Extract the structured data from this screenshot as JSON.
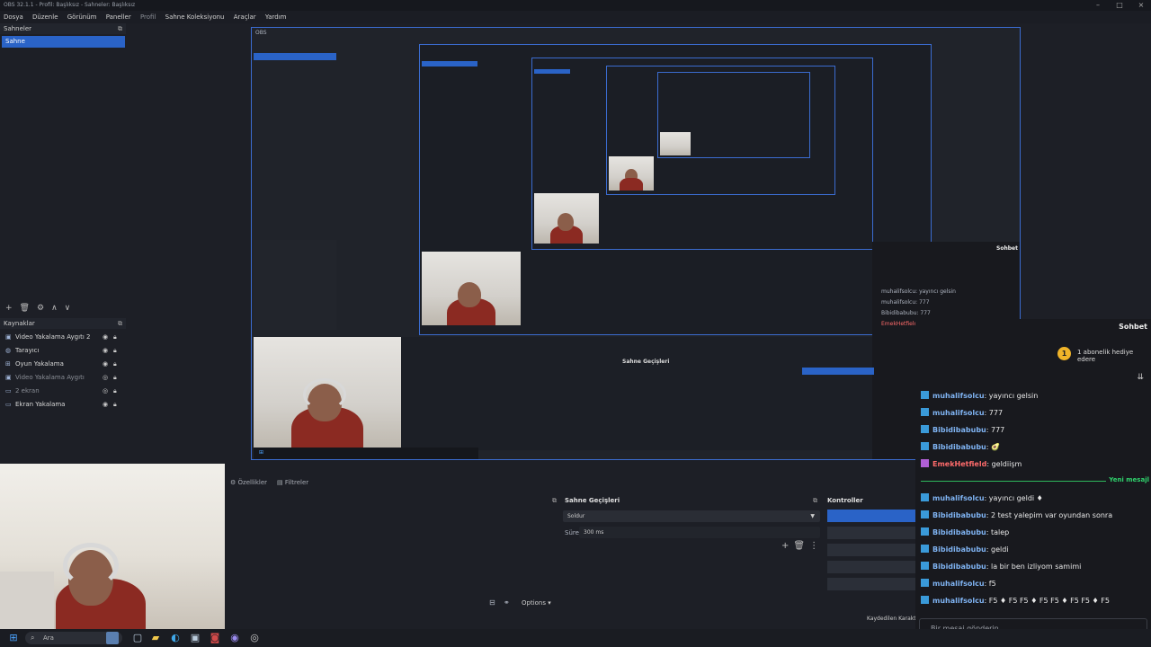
{
  "window": {
    "title": "OBS 32.1.1 - Profil: Başlıksız - Sahneler: Başlıksız"
  },
  "menu": [
    "Dosya",
    "Düzenle",
    "Görünüm",
    "Paneller",
    "Profil",
    "Sahne Koleksiyonu",
    "Araçlar",
    "Yardım"
  ],
  "scenes": {
    "title": "Sahneler",
    "items": [
      "Sahne"
    ]
  },
  "sources": {
    "title": "Kaynaklar",
    "items": [
      {
        "name": "Video Yakalama Aygıtı 2",
        "enabled": true
      },
      {
        "name": "Tarayıcı",
        "enabled": true
      },
      {
        "name": "Oyun Yakalama",
        "enabled": true
      },
      {
        "name": "Video Yakalama Aygıtı",
        "enabled": false
      },
      {
        "name": "2 ekran",
        "enabled": false
      },
      {
        "name": "Ekran Yakalama",
        "enabled": true
      }
    ]
  },
  "controls_bar": {
    "tab_properties": "Özellikler",
    "tab_filters": "Filtreler",
    "options_label": "Options"
  },
  "transitions": {
    "title": "Sahne Geçişleri",
    "selected": "Soldur",
    "duration_label": "Süre",
    "duration_value": "300 ms"
  },
  "controls": {
    "title": "Kontroller",
    "partial_text": "Kaydedilen Karakt"
  },
  "chat": {
    "title": "Sohbet",
    "gift_count": "1",
    "gift_text": "1 abonelik hediye edere",
    "new_messages_label": "Yeni mesajl",
    "input_placeholder": "Bir mesaj gönderin",
    "messages": [
      {
        "user": "muhalifsolcu",
        "text": ": yayıncı gelsin",
        "color": "blue"
      },
      {
        "user": "muhalifsolcu",
        "text": ": 777",
        "color": "blue"
      },
      {
        "user": "Bibidibabubu",
        "text": ": 777",
        "color": "blue"
      },
      {
        "user": "Bibidibabubu",
        "text": ": 🥑",
        "color": "blue"
      },
      {
        "user": "EmekHetfield",
        "text": ": geldiişm",
        "color": "red"
      },
      {
        "user": "muhalifsolcu",
        "text": ": yayıncı geldi ♦",
        "color": "blue"
      },
      {
        "user": "Bibidibabubu",
        "text": ": 2 test yalepim var oyundan sonra",
        "color": "blue"
      },
      {
        "user": "Bibidibabubu",
        "text": ": talep",
        "color": "blue"
      },
      {
        "user": "Bibidibabubu",
        "text": ": geldi",
        "color": "blue"
      },
      {
        "user": "Bibidibabubu",
        "text": ": la bir ben izliyom samimi",
        "color": "blue"
      },
      {
        "user": "muhalifsolcu",
        "text": ": f5",
        "color": "blue"
      },
      {
        "user": "muhalifsolcu",
        "text": ": F5 ♦ F5 F5 ♦ F5 F5 ♦ F5 F5 ♦ F5",
        "color": "blue"
      }
    ]
  },
  "taskbar": {
    "search_placeholder": "Ara"
  }
}
